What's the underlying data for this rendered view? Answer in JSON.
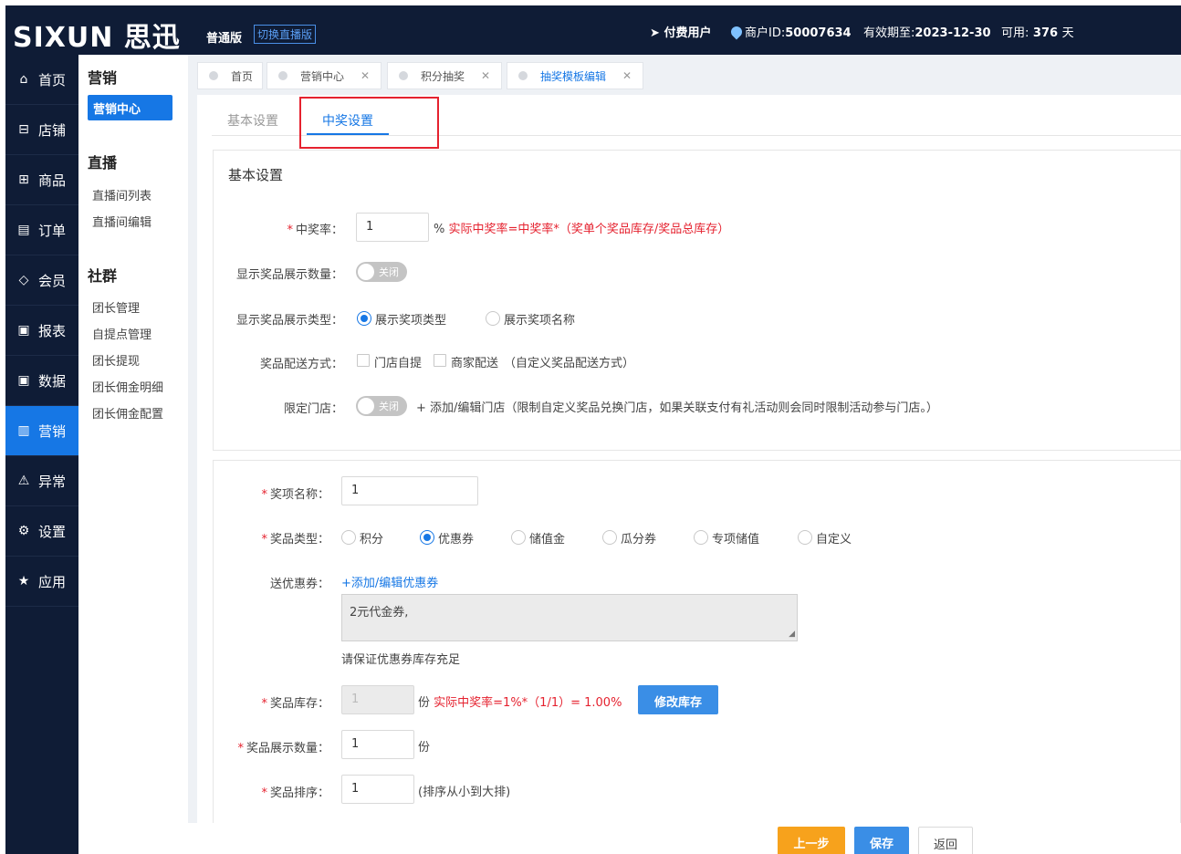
{
  "header": {
    "logo": "SIXUN 思迅",
    "edition": "普通版",
    "switch_label": "切换直播版",
    "paid_user": "付费用户",
    "merchant_label": "商户ID:",
    "merchant_id": "50007634",
    "expiry_label": "有效期至:",
    "expiry_date": "2023-12-30",
    "available_label": "可用:",
    "available_days": "376",
    "days_unit": "天"
  },
  "sidebar": {
    "items": [
      {
        "label": "首页",
        "icon": "home-icon"
      },
      {
        "label": "店铺",
        "icon": "store-icon"
      },
      {
        "label": "商品",
        "icon": "gift-icon"
      },
      {
        "label": "订单",
        "icon": "order-icon"
      },
      {
        "label": "会员",
        "icon": "diamond-icon"
      },
      {
        "label": "报表",
        "icon": "report-icon"
      },
      {
        "label": "数据",
        "icon": "data-icon"
      },
      {
        "label": "营销",
        "icon": "bar-chart-icon",
        "active": true
      },
      {
        "label": "异常",
        "icon": "warning-icon"
      },
      {
        "label": "设置",
        "icon": "gear-icon"
      },
      {
        "label": "应用",
        "icon": "star-icon"
      }
    ]
  },
  "subnav": {
    "marketing_title": "营销",
    "marketing_center": "营销中心",
    "live_title": "直播",
    "live_list": "直播间列表",
    "live_edit": "直播间编辑",
    "community_title": "社群",
    "links": [
      "团长管理",
      "自提点管理",
      "团长提现",
      "团长佣金明细",
      "团长佣金配置"
    ]
  },
  "page_tabs": [
    "首页",
    "营销中心",
    "积分抽奖",
    "抽奖模板编辑"
  ],
  "close_glyph": "✕",
  "sub_tabs": {
    "basic": "基本设置",
    "prize": "中奖设置"
  },
  "basic_card": {
    "title": "基本设置",
    "win_rate_label": "中奖率：",
    "win_rate_value": "1",
    "percent": "%",
    "win_rate_hint": "实际中奖率=中奖率*（奖单个奖品库存/奖品总库存）",
    "show_qty_label": "显示奖品展示数量：",
    "toggle_off": "关闭",
    "show_type_label": "显示奖品展示类型：",
    "show_type_options": [
      "展示奖项类型",
      "展示奖项名称"
    ],
    "delivery_label": "奖品配送方式：",
    "delivery_options": [
      "门店自提",
      "商家配送"
    ],
    "delivery_custom": "（自定义奖品配送方式）",
    "limit_store_label": "限定门店：",
    "limit_store_hint": "+ 添加/编辑门店（限制自定义奖品兑换门店，如果关联支付有礼活动则会同时限制活动参与门店。）"
  },
  "prize_card": {
    "name_label": "奖项名称：",
    "name_value": "1",
    "type_label": "奖品类型：",
    "type_options": [
      "积分",
      "优惠券",
      "储值金",
      "瓜分券",
      "专项储值",
      "自定义"
    ],
    "type_selected": 1,
    "coupon_label": "送优惠券：",
    "coupon_link": "+添加/编辑优惠券",
    "coupon_text": "2元代金券,",
    "coupon_warning": "请保证优惠券库存充足",
    "stock_label": "奖品库存：",
    "stock_value": "1",
    "unit": "份",
    "stock_hint": "实际中奖率=1%*（1/1）= 1.00%",
    "modify_stock": "修改库存",
    "display_qty_label": "奖品展示数量：",
    "display_qty_value": "1",
    "sort_label": "奖品排序：",
    "sort_value": "1",
    "sort_hint": "(排序从小到大排)"
  },
  "footer": {
    "prev": "上一步",
    "save": "保存",
    "back": "返回"
  }
}
